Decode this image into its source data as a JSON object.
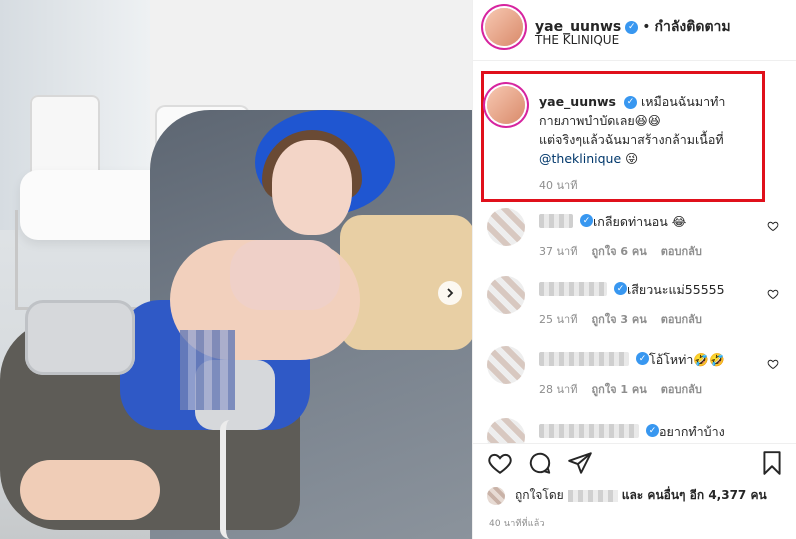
{
  "post": {
    "username": "yae_uunws",
    "follow_status": "กำลังติดตาม",
    "location": "THE KLINIQUE",
    "dot": "•"
  },
  "caption": {
    "username": "yae_uunws",
    "line1": "เหมือนฉันมาทำ",
    "line2": "กายภาพบำบัดเลย😆😆",
    "line3": "แต่จริงๆแล้วฉันมาสร้างกล้ามเนื้อที่",
    "mention": "@theklinique",
    "mention_suffix": " 😜",
    "time": "40 นาที"
  },
  "comments": [
    {
      "text": "เกลียดท่านอน 😂",
      "time": "37 นาที",
      "likes": "ถูกใจ 6 คน",
      "reply": "ตอบกลับ"
    },
    {
      "text": "เสียวนะแม่55555",
      "time": "25 นาที",
      "likes": "ถูกใจ 3 คน",
      "reply": "ตอบกลับ"
    },
    {
      "text": "โอ้โหท่า🤣🤣",
      "time": "28 นาที",
      "likes": "ถูกใจ 1 คน",
      "reply": "ตอบกลับ"
    },
    {
      "text": "อยากทำบ้าง"
    }
  ],
  "likes": {
    "prefix": "ถูกใจโดย",
    "suffix": "และ คนอื่นๆ อีก 4,377 คน"
  },
  "time_ago": "40 นาทีที่แล้ว",
  "colors": {
    "highlight": "#e0101b",
    "verified": "#3897f0",
    "mention": "#00376b"
  },
  "icons": {
    "heart": "heart-icon",
    "comment": "comment-icon",
    "share": "share-icon",
    "save": "bookmark-icon",
    "next": "chevron-right-icon"
  }
}
